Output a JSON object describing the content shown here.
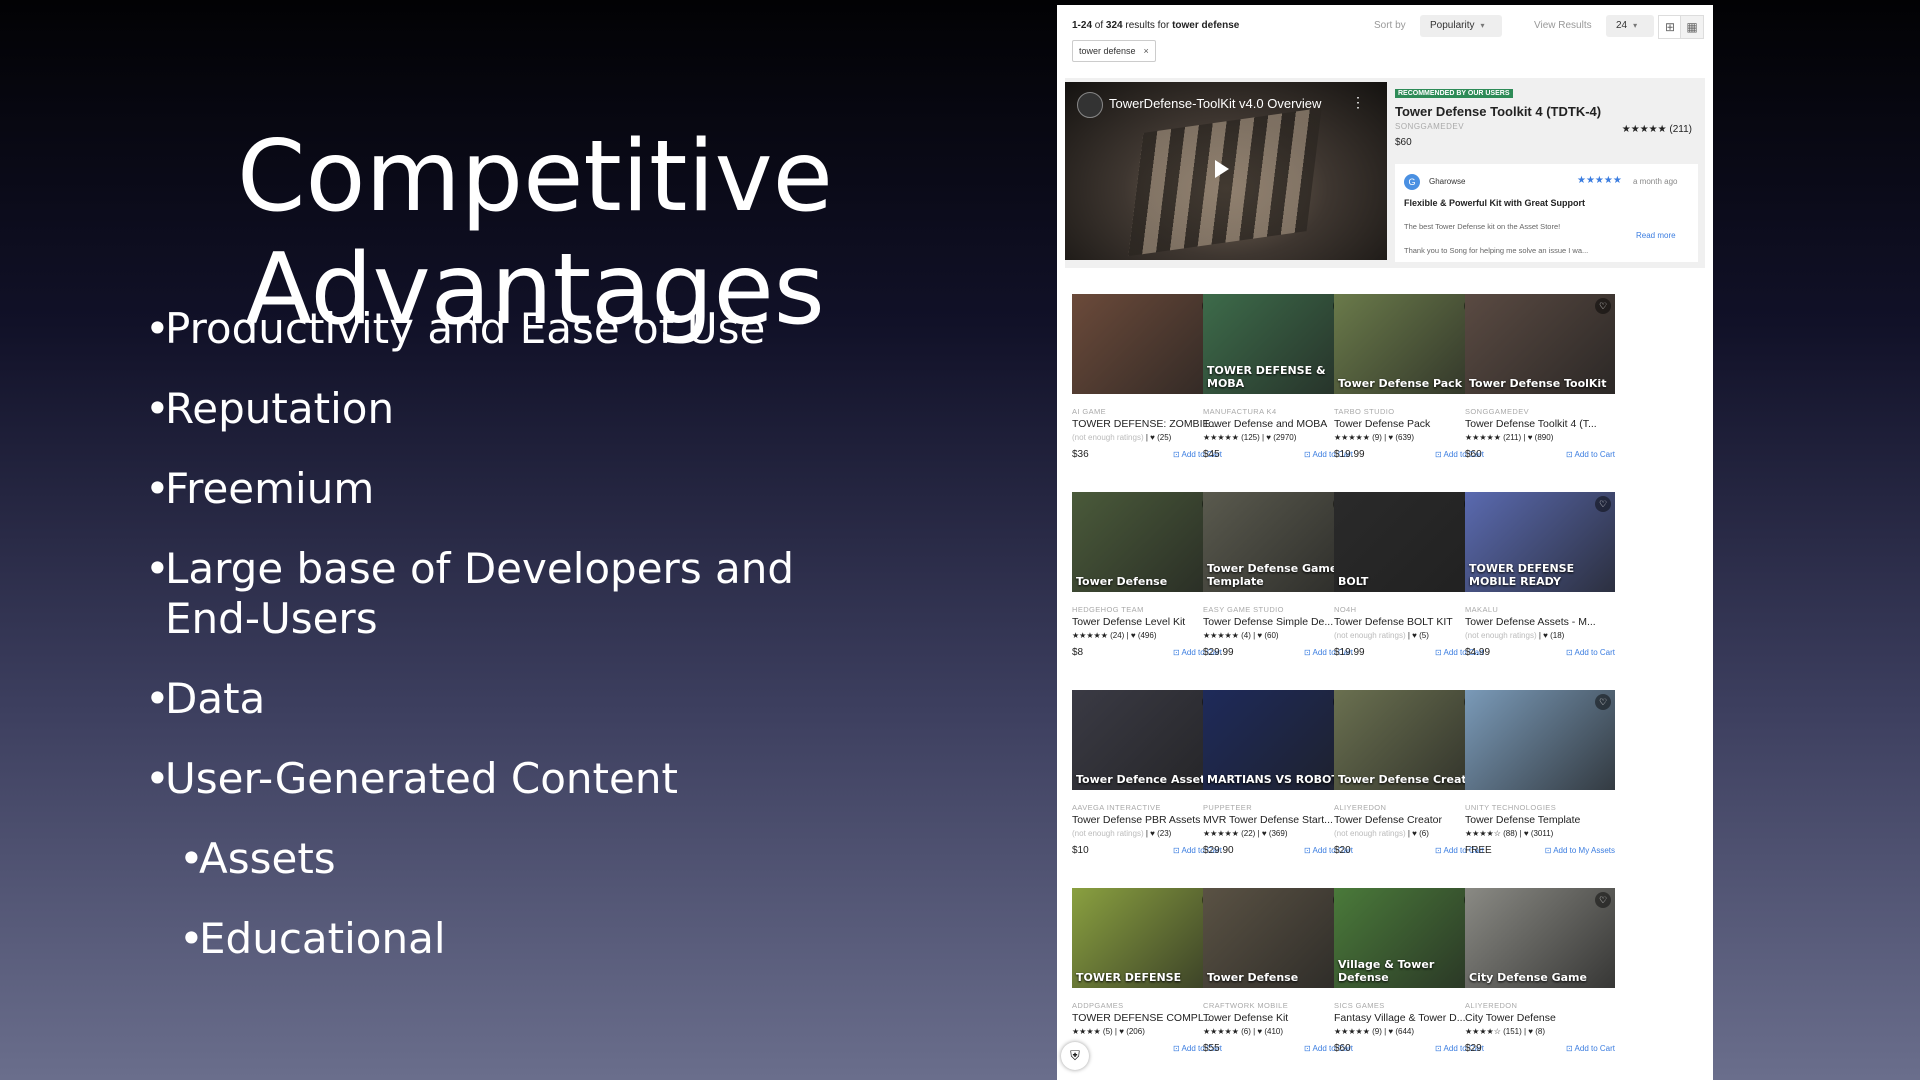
{
  "slide": {
    "title_line1": "Competitive",
    "title_line2": "Advantages",
    "bullets": [
      "Productivity and Ease of Use",
      "Reputation",
      "Freemium",
      "Large base of Developers and End-Users",
      "Data",
      "User-Generated Content"
    ],
    "sub_bullets": [
      "Assets",
      "Educational"
    ]
  },
  "store": {
    "results_range": "1-24",
    "results_of": "of",
    "results_total": "324",
    "results_for": "results for",
    "query": "tower defense",
    "sort_label": "Sort by",
    "sort_value": "Popularity",
    "view_label": "View Results",
    "view_value": "24",
    "filter_chip": "tower defense",
    "featured": {
      "video_title": "TowerDefense-ToolKit v4.0 Overview",
      "badge": "RECOMMENDED BY OUR USERS",
      "name": "Tower Defense Toolkit 4 (TDTK-4)",
      "publisher": "SONGGAMEDEV",
      "rating": "★★★★★ (211)",
      "price": "$60",
      "review": {
        "avatar": "G",
        "author": "Gharowse",
        "stars": "★★★★★",
        "time": "a month ago",
        "title": "Flexible & Powerful Kit with Great Support",
        "text1": "The best Tower Defense kit on the Asset Store!",
        "text2": "Thank you to Song for helping me solve an issue I wa...",
        "read_more": "Read more"
      }
    },
    "products": [
      {
        "publisher": "AI GAME",
        "name": "TOWER DEFENSE: ZOMBIE...",
        "rating": "(not enough ratings)",
        "likes": "♥ (25)",
        "price": "$36",
        "action": "Add to Cart",
        "thumb_text": "",
        "bg": "#6b4a3a"
      },
      {
        "publisher": "MANUFACTURA K4",
        "name": "Tower Defense and MOBA",
        "rating": "★★★★★ (125)",
        "likes": "♥ (2970)",
        "price": "$45",
        "action": "Add to Cart",
        "thumb_text": "TOWER DEFENSE & MOBA",
        "bg": "#3d6b4a"
      },
      {
        "publisher": "TARBO STUDIO",
        "name": "Tower Defense Pack",
        "rating": "★★★★★ (9)",
        "likes": "♥ (639)",
        "price": "$19.99",
        "action": "Add to Cart",
        "thumb_text": "Tower Defense Pack",
        "bg": "#6a7a4a"
      },
      {
        "publisher": "SONGGAMEDEV",
        "name": "Tower Defense Toolkit 4 (T...",
        "rating": "★★★★★ (211)",
        "likes": "♥ (890)",
        "price": "$60",
        "action": "Add to Cart",
        "thumb_text": "Tower Defense ToolKit",
        "bg": "#5a4a42"
      },
      {
        "publisher": "HEDGEHOG TEAM",
        "name": "Tower Defense Level Kit",
        "rating": "★★★★★ (24)",
        "likes": "♥ (496)",
        "price": "$8",
        "action": "Add to Cart",
        "thumb_text": "Tower Defense",
        "bg": "#4a5a3a"
      },
      {
        "publisher": "EASY GAME STUDIO",
        "name": "Tower Defense Simple De...",
        "rating": "★★★★★ (4)",
        "likes": "♥ (60)",
        "price": "$29.99",
        "action": "Add to Cart",
        "thumb_text": "Tower Defense Game Template",
        "bg": "#5a5a4e"
      },
      {
        "publisher": "NO4H",
        "name": "Tower Defense BOLT KIT",
        "rating": "(not enough ratings)",
        "likes": "♥ (5)",
        "price": "$19.99",
        "action": "Add to Cart",
        "thumb_text": "BOLT",
        "bg": "#2a2a2a"
      },
      {
        "publisher": "MAKALU",
        "name": "Tower Defense Assets - M...",
        "rating": "(not enough ratings)",
        "likes": "♥ (18)",
        "price": "$4.99",
        "action": "Add to Cart",
        "thumb_text": "TOWER DEFENSE MOBILE READY",
        "bg": "#5a6ab0"
      },
      {
        "publisher": "AAVEGA INTERACTIVE",
        "name": "Tower Defense PBR Assets",
        "rating": "(not enough ratings)",
        "likes": "♥ (23)",
        "price": "$10",
        "action": "Add to Cart",
        "thumb_text": "Tower Defence Assets",
        "bg": "#3a3a44"
      },
      {
        "publisher": "PUPPETEER",
        "name": "MVR Tower Defense Start...",
        "rating": "★★★★★ (22)",
        "likes": "♥ (369)",
        "price": "$29.90",
        "action": "Add to Cart",
        "thumb_text": "MARTIANS VS ROBOTS",
        "bg": "#1e2a5a"
      },
      {
        "publisher": "ALIYEREDON",
        "name": "Tower Defense Creator",
        "rating": "(not enough ratings)",
        "likes": "♥ (6)",
        "price": "$20",
        "action": "Add to Cart",
        "thumb_text": "Tower Defense Creator",
        "bg": "#6a7050"
      },
      {
        "publisher": "UNITY TECHNOLOGIES",
        "name": "Tower Defense Template",
        "rating": "★★★★☆ (88)",
        "likes": "♥ (3011)",
        "price": "FREE",
        "action": "Add to My Assets",
        "thumb_text": "",
        "bg": "#7a9ab8"
      },
      {
        "publisher": "ADDPGAMES",
        "name": "TOWER DEFENSE COMPL...",
        "rating": "★★★★ (5)",
        "likes": "♥ (206)",
        "price": "",
        "action": "Add to Cart",
        "thumb_text": "TOWER DEFENSE",
        "bg": "#8aa040"
      },
      {
        "publisher": "CRAFTWORK MOBILE",
        "name": "Tower Defense Kit",
        "rating": "★★★★★ (6)",
        "likes": "♥ (410)",
        "price": "$55",
        "action": "Add to Cart",
        "thumb_text": "Tower Defense",
        "bg": "#5a5244"
      },
      {
        "publisher": "SICS GAMES",
        "name": "Fantasy Village & Tower D...",
        "rating": "★★★★★ (9)",
        "likes": "♥ (644)",
        "price": "$60",
        "action": "Add to Cart",
        "thumb_text": "Village & Tower Defense",
        "bg": "#4a7a3a"
      },
      {
        "publisher": "ALIYEREDON",
        "name": "City Tower Defense",
        "rating": "★★★★☆ (151)",
        "likes": "♥ (8)",
        "price": "$29",
        "action": "Add to Cart",
        "thumb_text": "City Defense Game",
        "bg": "#8a8a84"
      }
    ]
  }
}
